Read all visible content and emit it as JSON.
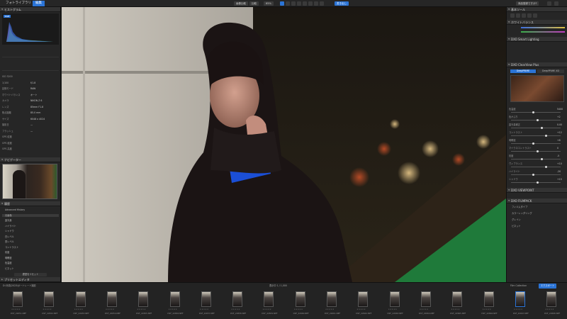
{
  "app": {
    "tabs": [
      "フォトライブラリ",
      "編集"
    ],
    "active_tab": "編集",
    "toolbar_buttons": [
      "画像比較",
      "比較"
    ],
    "zoom_label": "65%",
    "export_button": "書き出し",
    "top_right_button": "商品登録ですか?"
  },
  "left_panel": {
    "histogram_header": "ヒストグラム",
    "histogram_label": "RGB",
    "info_rows": [
      {
        "k": "ISO 3200",
        "v": ""
      },
      {
        "k": "1/100",
        "v": "f/1.8"
      },
      {
        "k": "記録モード",
        "v": "RAW"
      },
      {
        "k": "ホワイトバランス",
        "v": "オート"
      },
      {
        "k": "カメラ",
        "v": "NIKON Z 6"
      },
      {
        "k": "レンズ",
        "v": "85mm F1.8"
      },
      {
        "k": "焦点距離",
        "v": "85.0 mm"
      },
      {
        "k": "サイズ",
        "v": "6048 x 4024"
      },
      {
        "k": "撮影日",
        "v": "—"
      },
      {
        "k": "フラッシュ",
        "v": "—"
      },
      {
        "k": "GPS 緯度",
        "v": ""
      },
      {
        "k": "GPS 経度",
        "v": ""
      },
      {
        "k": "GPS 高度",
        "v": ""
      }
    ],
    "navigator_header": "ナビゲーター",
    "history_header": "履歴",
    "history_items": [
      "Advanced History",
      "元画像",
      "露光量",
      "ハイライト",
      "シャドウ",
      "白レベル",
      "黒レベル",
      "コントラスト",
      "彩度",
      "明瞭度",
      "色温度",
      "ビネット"
    ],
    "reset_label": "履歴をリセット",
    "bottom_header": "プリセットエディタ"
  },
  "right_panel": {
    "tool_header": "基本ツール",
    "sections": [
      "ホワイトバランス",
      "DXO Smart Lighting",
      "DXO ClearView Plus",
      "トーンカーブ",
      "選択的トーン",
      "カラー",
      "DXO VIEWPOINT",
      "DXO FILMPACK"
    ],
    "sliders": [
      {
        "label": "色温度",
        "value": "5400"
      },
      {
        "label": "色かぶり",
        "value": "+2"
      },
      {
        "label": "露光量補正",
        "value": "0.00"
      },
      {
        "label": "コントラスト",
        "value": "+12"
      },
      {
        "label": "明瞭度",
        "value": "+8"
      },
      {
        "label": "マイクロコントラスト",
        "value": "0"
      },
      {
        "label": "彩度",
        "value": "-5"
      },
      {
        "label": "ヴィブランス",
        "value": "+10"
      },
      {
        "label": "ハイライト",
        "value": "-20"
      },
      {
        "label": "シャドウ",
        "value": "+15"
      }
    ],
    "preset_mode": "DeepPRIME",
    "preset_mode2": "DeepPRIME XD",
    "filmpack_items": [
      "フィルムタイプ",
      "カラーレンダリング",
      "グレイン",
      "ビネット"
    ]
  },
  "filmstrip": {
    "path": "D:\\写真\\2023\\ポートレート撮影",
    "count_label": "表示中 1 / 1,000",
    "right_buttons": [
      "Film Collection",
      "エクスポート"
    ],
    "thumbs": [
      "DSF_22651.NEF",
      "DSF_22652.NEF",
      "DSF_22653.NEF",
      "DSF_22654.NEF",
      "DSF_22655.NEF",
      "DSF_22656.NEF",
      "DSF_22657.NEF",
      "DSF_22658.NEF",
      "DSF_22659.NEF",
      "DSF_22660.NEF",
      "DSF_22661.NEF",
      "DSF_22662.NEF",
      "DSF_22663.NEF",
      "DSF_22664.NEF",
      "DSF_22665.NEF",
      "DSF_22666.NEF",
      "DSF_22667.NEF",
      "DSF_22668.NEF"
    ]
  }
}
